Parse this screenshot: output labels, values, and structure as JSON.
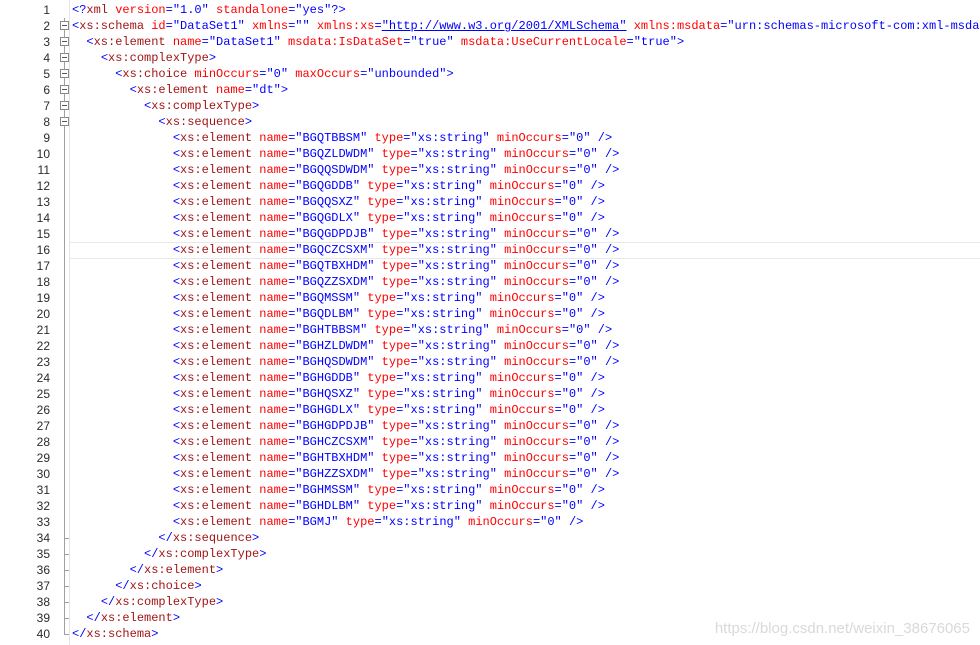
{
  "editor": {
    "current_line": 16,
    "lines": [
      {
        "n": "1",
        "fold": "none",
        "indent": "",
        "parts": [
          [
            "b",
            "<?"
          ],
          [
            "t",
            "xml"
          ],
          [
            "a",
            " version"
          ],
          [
            "b",
            "="
          ],
          [
            "q",
            "\"1.0\""
          ],
          [
            "a",
            " standalone"
          ],
          [
            "b",
            "="
          ],
          [
            "q",
            "\"yes\""
          ],
          [
            "b",
            "?>"
          ]
        ]
      },
      {
        "n": "2",
        "fold": "open",
        "indent": "",
        "parts": [
          [
            "b",
            "<"
          ],
          [
            "t",
            "xs:schema"
          ],
          [
            "a",
            " id"
          ],
          [
            "b",
            "="
          ],
          [
            "q",
            "\"DataSet1\""
          ],
          [
            "a",
            " xmlns"
          ],
          [
            "b",
            "="
          ],
          [
            "q",
            "\"\""
          ],
          [
            "a",
            " xmlns:xs"
          ],
          [
            "b",
            "="
          ],
          [
            "u",
            "\"http://www.w3.org/2001/XMLSchema\""
          ],
          [
            "a",
            " xmlns:msdata"
          ],
          [
            "b",
            "="
          ],
          [
            "q",
            "\"urn:schemas-microsoft-com:xml-msdata\""
          ],
          [
            "b",
            ">"
          ]
        ]
      },
      {
        "n": "3",
        "fold": "open",
        "indent": "  ",
        "parts": [
          [
            "b",
            "<"
          ],
          [
            "t",
            "xs:element"
          ],
          [
            "a",
            " name"
          ],
          [
            "b",
            "="
          ],
          [
            "q",
            "\"DataSet1\""
          ],
          [
            "a",
            " msdata:IsDataSet"
          ],
          [
            "b",
            "="
          ],
          [
            "q",
            "\"true\""
          ],
          [
            "a",
            " msdata:UseCurrentLocale"
          ],
          [
            "b",
            "="
          ],
          [
            "q",
            "\"true\""
          ],
          [
            "b",
            ">"
          ]
        ]
      },
      {
        "n": "4",
        "fold": "open",
        "indent": "    ",
        "parts": [
          [
            "b",
            "<"
          ],
          [
            "t",
            "xs:complexType"
          ],
          [
            "b",
            ">"
          ]
        ]
      },
      {
        "n": "5",
        "fold": "open",
        "indent": "      ",
        "parts": [
          [
            "b",
            "<"
          ],
          [
            "t",
            "xs:choice"
          ],
          [
            "a",
            " minOccurs"
          ],
          [
            "b",
            "="
          ],
          [
            "q",
            "\"0\""
          ],
          [
            "a",
            " maxOccurs"
          ],
          [
            "b",
            "="
          ],
          [
            "q",
            "\"unbounded\""
          ],
          [
            "b",
            ">"
          ]
        ]
      },
      {
        "n": "6",
        "fold": "open",
        "indent": "        ",
        "parts": [
          [
            "b",
            "<"
          ],
          [
            "t",
            "xs:element"
          ],
          [
            "a",
            " name"
          ],
          [
            "b",
            "="
          ],
          [
            "q",
            "\"dt\""
          ],
          [
            "b",
            ">"
          ]
        ]
      },
      {
        "n": "7",
        "fold": "open",
        "indent": "          ",
        "parts": [
          [
            "b",
            "<"
          ],
          [
            "t",
            "xs:complexType"
          ],
          [
            "b",
            ">"
          ]
        ]
      },
      {
        "n": "8",
        "fold": "open",
        "indent": "            ",
        "parts": [
          [
            "b",
            "<"
          ],
          [
            "t",
            "xs:sequence"
          ],
          [
            "b",
            ">"
          ]
        ]
      },
      {
        "n": "9",
        "fold": "line",
        "indent": "              ",
        "el": "BGQTBBSM"
      },
      {
        "n": "10",
        "fold": "line",
        "indent": "              ",
        "el": "BGQZLDWDM"
      },
      {
        "n": "11",
        "fold": "line",
        "indent": "              ",
        "el": "BGQQSDWDM"
      },
      {
        "n": "12",
        "fold": "line",
        "indent": "              ",
        "el": "BGQGDDB"
      },
      {
        "n": "13",
        "fold": "line",
        "indent": "              ",
        "el": "BGQQSXZ"
      },
      {
        "n": "14",
        "fold": "line",
        "indent": "              ",
        "el": "BGQGDLX"
      },
      {
        "n": "15",
        "fold": "line",
        "indent": "              ",
        "el": "BGQGDPDJB"
      },
      {
        "n": "16",
        "fold": "line",
        "indent": "              ",
        "el": "BGQCZCSXM"
      },
      {
        "n": "17",
        "fold": "line",
        "indent": "              ",
        "el": "BGQTBXHDM"
      },
      {
        "n": "18",
        "fold": "line",
        "indent": "              ",
        "el": "BGQZZSXDM"
      },
      {
        "n": "19",
        "fold": "line",
        "indent": "              ",
        "el": "BGQMSSM"
      },
      {
        "n": "20",
        "fold": "line",
        "indent": "              ",
        "el": "BGQDLBM"
      },
      {
        "n": "21",
        "fold": "line",
        "indent": "              ",
        "el": "BGHTBBSM"
      },
      {
        "n": "22",
        "fold": "line",
        "indent": "              ",
        "el": "BGHZLDWDM"
      },
      {
        "n": "23",
        "fold": "line",
        "indent": "              ",
        "el": "BGHQSDWDM"
      },
      {
        "n": "24",
        "fold": "line",
        "indent": "              ",
        "el": "BGHGDDB"
      },
      {
        "n": "25",
        "fold": "line",
        "indent": "              ",
        "el": "BGHQSXZ"
      },
      {
        "n": "26",
        "fold": "line",
        "indent": "              ",
        "el": "BGHGDLX"
      },
      {
        "n": "27",
        "fold": "line",
        "indent": "              ",
        "el": "BGHGDPDJB"
      },
      {
        "n": "28",
        "fold": "line",
        "indent": "              ",
        "el": "BGHCZCSXM"
      },
      {
        "n": "29",
        "fold": "line",
        "indent": "              ",
        "el": "BGHTBXHDM"
      },
      {
        "n": "30",
        "fold": "line",
        "indent": "              ",
        "el": "BGHZZSXDM"
      },
      {
        "n": "31",
        "fold": "line",
        "indent": "              ",
        "el": "BGHMSSM"
      },
      {
        "n": "32",
        "fold": "line",
        "indent": "              ",
        "el": "BGHDLBM"
      },
      {
        "n": "33",
        "fold": "line",
        "indent": "              ",
        "el": "BGMJ"
      },
      {
        "n": "34",
        "fold": "end",
        "indent": "            ",
        "parts": [
          [
            "b",
            "</"
          ],
          [
            "t",
            "xs:sequence"
          ],
          [
            "b",
            ">"
          ]
        ]
      },
      {
        "n": "35",
        "fold": "end",
        "indent": "          ",
        "parts": [
          [
            "b",
            "</"
          ],
          [
            "t",
            "xs:complexType"
          ],
          [
            "b",
            ">"
          ]
        ]
      },
      {
        "n": "36",
        "fold": "end",
        "indent": "        ",
        "parts": [
          [
            "b",
            "</"
          ],
          [
            "t",
            "xs:element"
          ],
          [
            "b",
            ">"
          ]
        ]
      },
      {
        "n": "37",
        "fold": "end",
        "indent": "      ",
        "parts": [
          [
            "b",
            "</"
          ],
          [
            "t",
            "xs:choice"
          ],
          [
            "b",
            ">"
          ]
        ]
      },
      {
        "n": "38",
        "fold": "end",
        "indent": "    ",
        "parts": [
          [
            "b",
            "</"
          ],
          [
            "t",
            "xs:complexType"
          ],
          [
            "b",
            ">"
          ]
        ]
      },
      {
        "n": "39",
        "fold": "end",
        "indent": "  ",
        "parts": [
          [
            "b",
            "</"
          ],
          [
            "t",
            "xs:element"
          ],
          [
            "b",
            ">"
          ]
        ]
      },
      {
        "n": "40",
        "fold": "end",
        "indent": "",
        "parts": [
          [
            "b",
            "</"
          ],
          [
            "t",
            "xs:schema"
          ],
          [
            "b",
            ">"
          ]
        ]
      }
    ],
    "element_template": {
      "open": "<",
      "tag": "xs:element",
      "name_attr": " name",
      "eq": "=",
      "type_attr": " type",
      "type_value": "\"xs:string\"",
      "min_attr": " minOccurs",
      "min_value": "\"0\"",
      "close": " />"
    }
  },
  "watermark": "https://blog.csdn.net/weixin_38676065"
}
